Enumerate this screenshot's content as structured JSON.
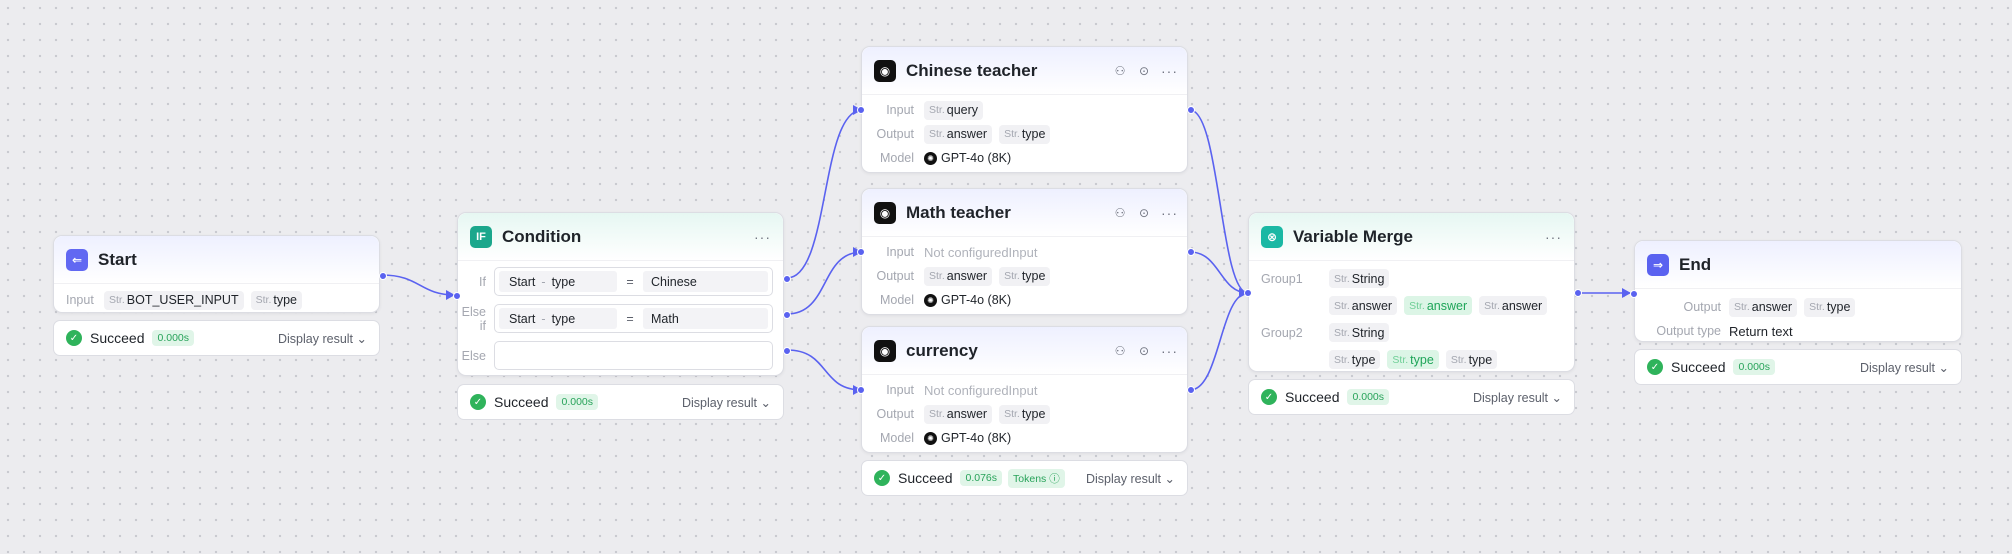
{
  "nodes": {
    "start": {
      "title": "Start",
      "input_label": "Input",
      "params": [
        "BOT_USER_INPUT",
        "type"
      ],
      "result": {
        "status": "Succeed",
        "time": "0.000s",
        "action": "Display result"
      }
    },
    "condition": {
      "title": "Condition",
      "icon_text": "IF",
      "branches": [
        {
          "label": "If",
          "var_node": "Start",
          "var_sep": "-",
          "var_name": "type",
          "op": "=",
          "value": "Chinese"
        },
        {
          "label": "Else if",
          "var_node": "Start",
          "var_sep": "-",
          "var_name": "type",
          "op": "=",
          "value": "Math"
        },
        {
          "label": "Else"
        }
      ],
      "result": {
        "status": "Succeed",
        "time": "0.000s",
        "action": "Display result"
      }
    },
    "chinese": {
      "title": "Chinese teacher",
      "input_label": "Input",
      "input": "query",
      "output_label": "Output",
      "outputs": [
        "answer",
        "type"
      ],
      "model_label": "Model",
      "model": "GPT-4o (8K)"
    },
    "math": {
      "title": "Math teacher",
      "input_label": "Input",
      "input_empty": "Not configuredInput",
      "output_label": "Output",
      "outputs": [
        "answer",
        "type"
      ],
      "model_label": "Model",
      "model": "GPT-4o (8K)"
    },
    "currency": {
      "title": "currency",
      "input_label": "Input",
      "input_empty": "Not configuredInput",
      "output_label": "Output",
      "outputs": [
        "answer",
        "type"
      ],
      "model_label": "Model",
      "model": "GPT-4o (8K)",
      "result": {
        "status": "Succeed",
        "time": "0.076s",
        "tokens": "Tokens",
        "action": "Display result"
      }
    },
    "merge": {
      "title": "Variable Merge",
      "group1_label": "Group1",
      "group1_type": "String",
      "group1_vars": [
        "answer",
        "answer",
        "answer"
      ],
      "group2_label": "Group2",
      "group2_type": "String",
      "group2_vars": [
        "type",
        "type",
        "type"
      ],
      "result": {
        "status": "Succeed",
        "time": "0.000s",
        "action": "Display result"
      }
    },
    "end": {
      "title": "End",
      "output_label": "Output",
      "outputs": [
        "answer",
        "type"
      ],
      "output_type_label": "Output type",
      "output_type": "Return text",
      "result": {
        "status": "Succeed",
        "time": "0.000s",
        "action": "Display result"
      }
    }
  },
  "type_prefix": "Str.",
  "colors": {
    "accent": "#5a62f0",
    "success": "#2fb35b",
    "edge": "#5a62f0"
  }
}
